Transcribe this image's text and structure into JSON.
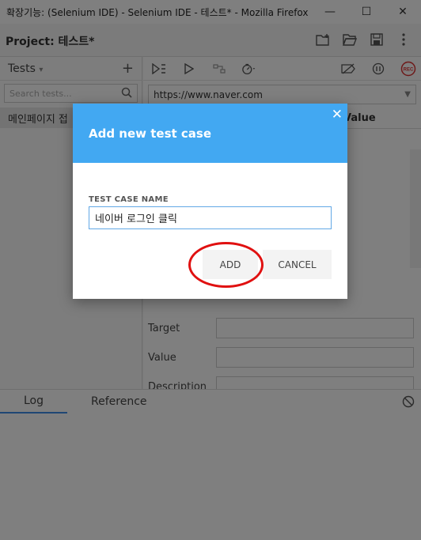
{
  "window": {
    "title": "확장기능: (Selenium IDE) - Selenium IDE - 테스트* - Mozilla Firefox",
    "minimize": "—",
    "maximize": "☐",
    "close": "✕"
  },
  "project": {
    "label": "Project:",
    "name": "테스트*"
  },
  "tests_panel": {
    "header": "Tests",
    "dropdown_glyph": "▾",
    "add_glyph": "+",
    "search_placeholder": "Search tests...",
    "items": [
      {
        "label": "메인페이지 접"
      }
    ]
  },
  "editor": {
    "base_url": "https://www.naver.com",
    "value_column": "Value",
    "fields": {
      "target": "Target",
      "value": "Value",
      "description": "Description"
    },
    "rec_label": "REC"
  },
  "bottom_tabs": {
    "log": "Log",
    "reference": "Reference"
  },
  "dialog": {
    "title": "Add new test case",
    "close_glyph": "✕",
    "field_label": "TEST CASE NAME",
    "field_value": "네이버 로그인 클릭",
    "add_button": "ADD",
    "cancel_button": "CANCEL"
  },
  "colors": {
    "dialog_header": "#42a8f2",
    "annotation_circle": "#e01010",
    "overlay": "rgba(0,0,0,0.5)"
  }
}
